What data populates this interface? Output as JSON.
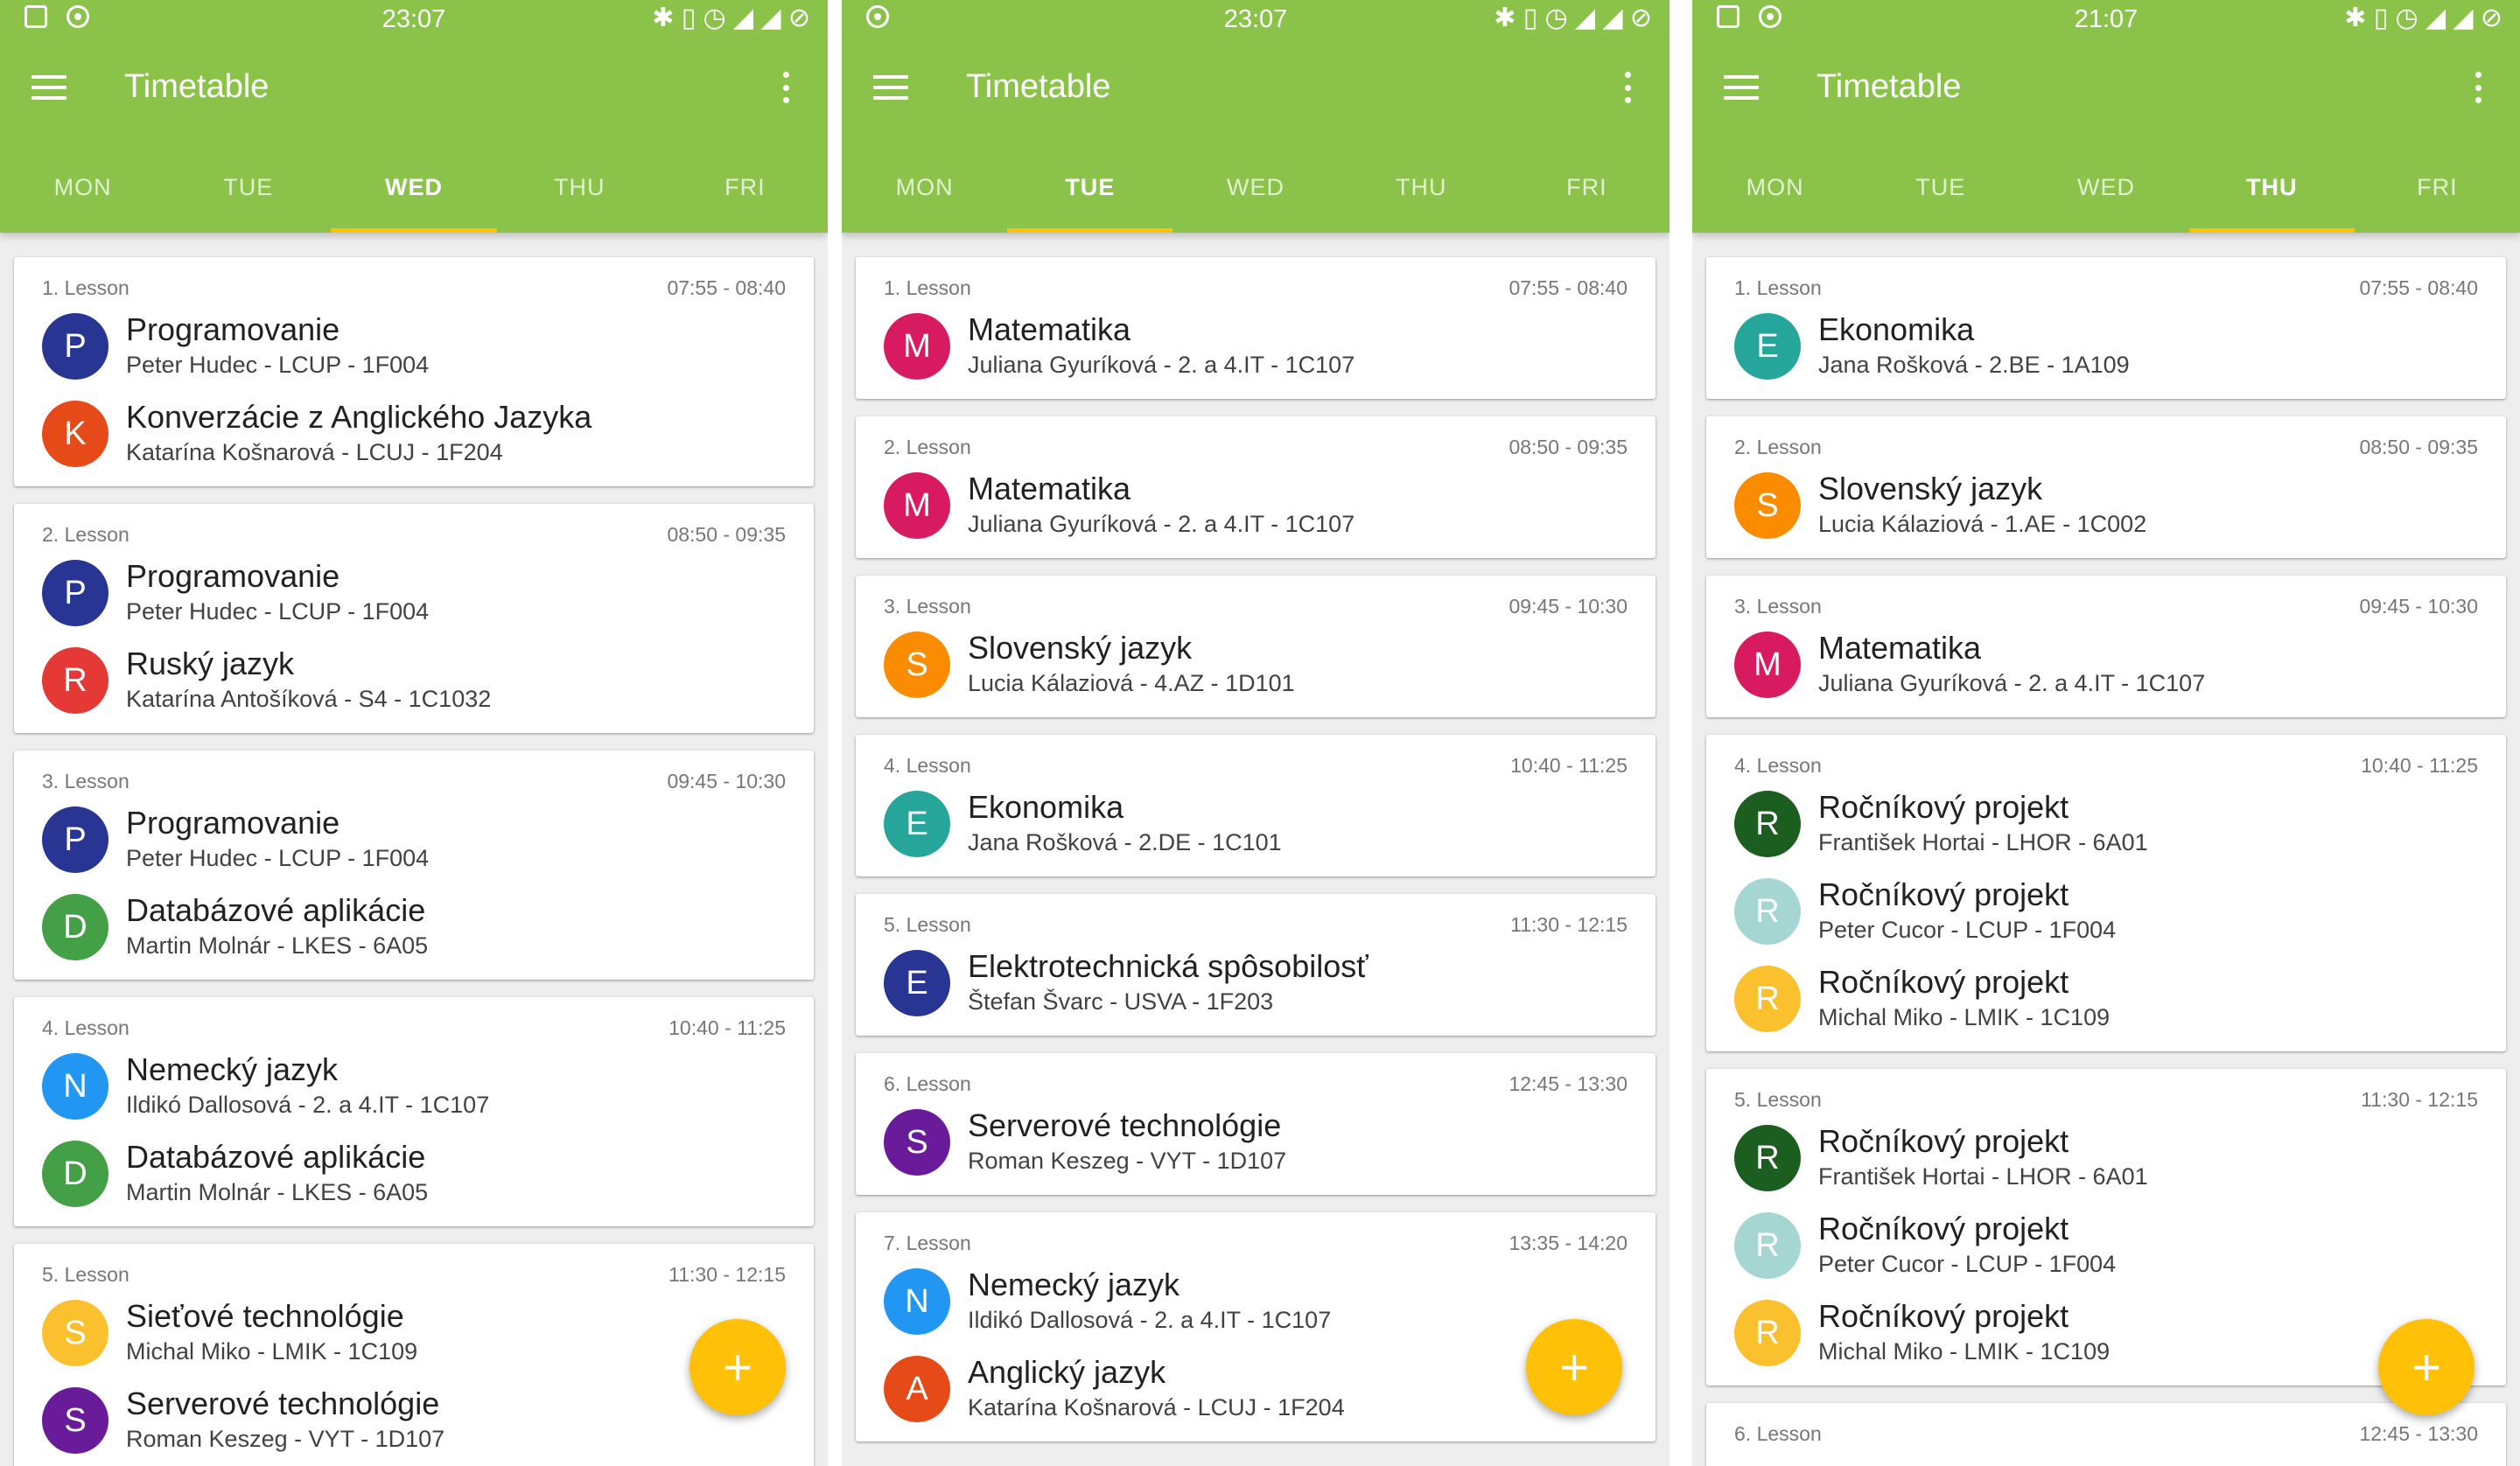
{
  "app_title": "Timetable",
  "colors": {
    "primary": "#8bc34a",
    "accent": "#ffc107",
    "background": "#eeeeee"
  },
  "day_labels": [
    "MON",
    "TUE",
    "WED",
    "THU",
    "FRI"
  ],
  "lesson_label": "Lesson",
  "fab_icon": "+",
  "phones": [
    {
      "status_time": "23:07",
      "status_right": "✱ ▯ ◷ ◢ ◢ ⊘",
      "active_tab": "WED",
      "lessons": [
        {
          "number": "1. Lesson",
          "time": "07:55 - 08:40",
          "entries": [
            {
              "letter": "P",
              "color": "#283593",
              "subject": "Programovanie",
              "details": "Peter Hudec - LCUP - 1F004"
            },
            {
              "letter": "K",
              "color": "#e64a19",
              "subject": "Konverzácie z Anglického Jazyka",
              "details": "Katarína Košnarová - LCUJ - 1F204"
            }
          ]
        },
        {
          "number": "2. Lesson",
          "time": "08:50 - 09:35",
          "entries": [
            {
              "letter": "P",
              "color": "#283593",
              "subject": "Programovanie",
              "details": "Peter Hudec - LCUP - 1F004"
            },
            {
              "letter": "R",
              "color": "#e53935",
              "subject": "Ruský jazyk",
              "details": "Katarína Antošíková - S4 - 1C1032"
            }
          ]
        },
        {
          "number": "3. Lesson",
          "time": "09:45 - 10:30",
          "entries": [
            {
              "letter": "P",
              "color": "#283593",
              "subject": "Programovanie",
              "details": "Peter Hudec - LCUP - 1F004"
            },
            {
              "letter": "D",
              "color": "#43a047",
              "subject": "Databázové aplikácie",
              "details": "Martin Molnár - LKES - 6A05"
            }
          ]
        },
        {
          "number": "4. Lesson",
          "time": "10:40 - 11:25",
          "entries": [
            {
              "letter": "N",
              "color": "#2196f3",
              "subject": "Nemecký jazyk",
              "details": "Ildikó Dallosová - 2. a 4.IT - 1C107"
            },
            {
              "letter": "D",
              "color": "#43a047",
              "subject": "Databázové aplikácie",
              "details": "Martin Molnár - LKES - 6A05"
            }
          ]
        },
        {
          "number": "5. Lesson",
          "time": "11:30 - 12:15",
          "entries": [
            {
              "letter": "S",
              "color": "#fbc02d",
              "subject": "Sieťové technológie",
              "details": "Michal Miko - LMIK - 1C109"
            },
            {
              "letter": "S",
              "color": "#6a1b9a",
              "subject": "Serverové technológie",
              "details": "Roman Keszeg - VYT - 1D107"
            }
          ]
        }
      ]
    },
    {
      "status_time": "23:07",
      "status_right": "✱ ▯ ◷ ◢ ◢ ⊘",
      "active_tab": "TUE",
      "lessons": [
        {
          "number": "1. Lesson",
          "time": "07:55 - 08:40",
          "entries": [
            {
              "letter": "M",
              "color": "#d81b60",
              "subject": "Matematika",
              "details": "Juliana Gyuríková - 2. a 4.IT - 1C107"
            }
          ]
        },
        {
          "number": "2. Lesson",
          "time": "08:50 - 09:35",
          "entries": [
            {
              "letter": "M",
              "color": "#d81b60",
              "subject": "Matematika",
              "details": "Juliana Gyuríková - 2. a 4.IT - 1C107"
            }
          ]
        },
        {
          "number": "3. Lesson",
          "time": "09:45 - 10:30",
          "entries": [
            {
              "letter": "S",
              "color": "#fb8c00",
              "subject": "Slovenský jazyk",
              "details": "Lucia Kálaziová - 4.AZ - 1D101"
            }
          ]
        },
        {
          "number": "4. Lesson",
          "time": "10:40 - 11:25",
          "entries": [
            {
              "letter": "E",
              "color": "#26a69a",
              "subject": "Ekonomika",
              "details": "Jana Rošková - 2.DE - 1C101"
            }
          ]
        },
        {
          "number": "5. Lesson",
          "time": "11:30 - 12:15",
          "entries": [
            {
              "letter": "E",
              "color": "#283593",
              "subject": "Elektrotechnická spôsobilosť",
              "details": "Štefan Švarc - USVA - 1F203"
            }
          ]
        },
        {
          "number": "6. Lesson",
          "time": "12:45 - 13:30",
          "entries": [
            {
              "letter": "S",
              "color": "#6a1b9a",
              "subject": "Serverové technológie",
              "details": "Roman Keszeg - VYT - 1D107"
            }
          ]
        },
        {
          "number": "7. Lesson",
          "time": "13:35 - 14:20",
          "entries": [
            {
              "letter": "N",
              "color": "#2196f3",
              "subject": "Nemecký jazyk",
              "details": "Ildikó Dallosová - 2. a 4.IT - 1C107"
            },
            {
              "letter": "A",
              "color": "#e64a19",
              "subject": "Anglický jazyk",
              "details": "Katarína Košnarová - LCUJ - 1F204"
            }
          ]
        }
      ]
    },
    {
      "status_time": "21:07",
      "status_right": "✱ ▯ ◷ ◢ ◢ ⊘",
      "active_tab": "THU",
      "lessons": [
        {
          "number": "1. Lesson",
          "time": "07:55 - 08:40",
          "entries": [
            {
              "letter": "E",
              "color": "#26a69a",
              "subject": "Ekonomika",
              "details": "Jana Rošková - 2.BE - 1A109"
            }
          ]
        },
        {
          "number": "2. Lesson",
          "time": "08:50 - 09:35",
          "entries": [
            {
              "letter": "S",
              "color": "#fb8c00",
              "subject": "Slovenský jazyk",
              "details": "Lucia Kálaziová - 1.AE - 1C002"
            }
          ]
        },
        {
          "number": "3. Lesson",
          "time": "09:45 - 10:30",
          "entries": [
            {
              "letter": "M",
              "color": "#d81b60",
              "subject": "Matematika",
              "details": "Juliana Gyuríková - 2. a 4.IT - 1C107"
            }
          ]
        },
        {
          "number": "4. Lesson",
          "time": "10:40 - 11:25",
          "entries": [
            {
              "letter": "R",
              "color": "#1b5e20",
              "subject": "Ročníkový projekt",
              "details": "František Hortai - LHOR - 6A01"
            },
            {
              "letter": "R",
              "color": "#a5d6d1",
              "subject": "Ročníkový projekt",
              "details": "Peter Cucor - LCUP - 1F004"
            },
            {
              "letter": "R",
              "color": "#fbc02d",
              "subject": "Ročníkový projekt",
              "details": "Michal Miko - LMIK - 1C109"
            }
          ]
        },
        {
          "number": "5. Lesson",
          "time": "11:30 - 12:15",
          "entries": [
            {
              "letter": "R",
              "color": "#1b5e20",
              "subject": "Ročníkový projekt",
              "details": "František Hortai - LHOR - 6A01"
            },
            {
              "letter": "R",
              "color": "#a5d6d1",
              "subject": "Ročníkový projekt",
              "details": "Peter Cucor - LCUP - 1F004"
            },
            {
              "letter": "R",
              "color": "#fbc02d",
              "subject": "Ročníkový projekt",
              "details": "Michal Miko - LMIK - 1C109"
            }
          ]
        },
        {
          "number": "6. Lesson",
          "time": "12:45 - 13:30",
          "entries": []
        }
      ]
    }
  ]
}
